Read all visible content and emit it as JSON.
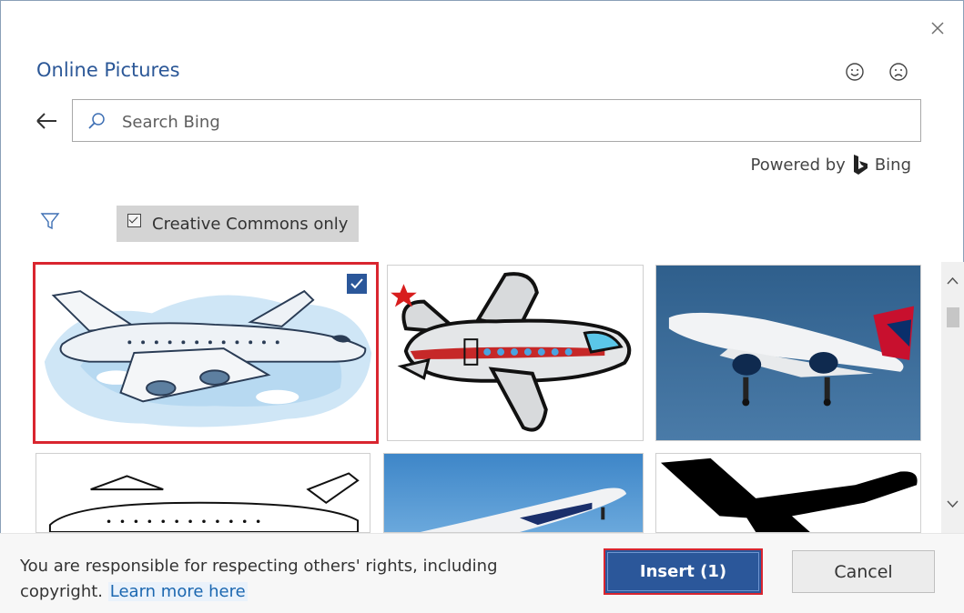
{
  "dialog": {
    "title": "Online Pictures",
    "close_icon": "close-icon",
    "feedback": {
      "smile_icon": "smiley-icon",
      "frown_icon": "frown-icon"
    }
  },
  "search": {
    "back_icon": "back-arrow-icon",
    "icon": "search-icon",
    "placeholder": "Search Bing",
    "value": ""
  },
  "powered_by": {
    "label": "Powered by",
    "brand": "Bing",
    "brand_icon": "bing-logo-icon"
  },
  "filters": {
    "filter_icon": "filter-icon",
    "creative_commons_label": "Creative Commons only",
    "creative_commons_checked": true
  },
  "results": {
    "items": [
      {
        "description": "cartoon airplane in clouds",
        "selected": true
      },
      {
        "description": "cartoon airplane with red stripe",
        "selected": false
      },
      {
        "description": "Delta airliner photo",
        "selected": false
      },
      {
        "description": "outline airplane drawing",
        "selected": false
      },
      {
        "description": "airliner taking off photo",
        "selected": false
      },
      {
        "description": "airplane silhouette",
        "selected": false
      }
    ]
  },
  "footer": {
    "notice": "You are responsible for respecting others' rights, including copyright.",
    "learn_more": "Learn more here",
    "insert_label": "Insert (1)",
    "cancel_label": "Cancel"
  },
  "colors": {
    "accent": "#2b579a",
    "selection": "#d9252f",
    "title": "#2b5797"
  }
}
